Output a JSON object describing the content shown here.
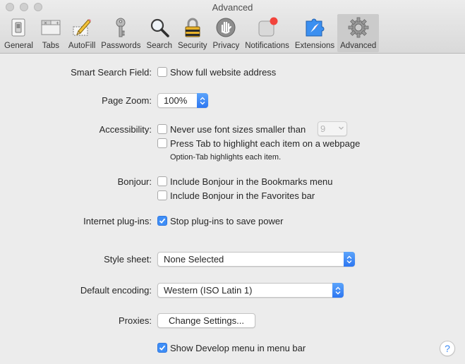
{
  "window": {
    "title": "Advanced"
  },
  "toolbar": {
    "items": [
      {
        "label": "General",
        "icon": "general-switch-icon"
      },
      {
        "label": "Tabs",
        "icon": "tabs-icon"
      },
      {
        "label": "AutoFill",
        "icon": "autofill-pencil-icon"
      },
      {
        "label": "Passwords",
        "icon": "key-icon"
      },
      {
        "label": "Search",
        "icon": "magnifier-icon"
      },
      {
        "label": "Security",
        "icon": "padlock-icon"
      },
      {
        "label": "Privacy",
        "icon": "hand-icon"
      },
      {
        "label": "Notifications",
        "icon": "notification-badge-icon"
      },
      {
        "label": "Extensions",
        "icon": "puzzle-compass-icon"
      },
      {
        "label": "Advanced",
        "icon": "gear-icon",
        "selected": true
      }
    ]
  },
  "settings": {
    "smart_search": {
      "label": "Smart Search Field:",
      "option": "Show full website address",
      "checked": false
    },
    "page_zoom": {
      "label": "Page Zoom:",
      "value": "100%"
    },
    "accessibility": {
      "label": "Accessibility:",
      "font_size_option": "Never use font sizes smaller than",
      "font_size_checked": false,
      "font_size_value": "9",
      "tab_option": "Press Tab to highlight each item on a webpage",
      "tab_checked": false,
      "tab_note": "Option-Tab highlights each item."
    },
    "bonjour": {
      "label": "Bonjour:",
      "bookmarks_option": "Include Bonjour in the Bookmarks menu",
      "bookmarks_checked": false,
      "favorites_option": "Include Bonjour in the Favorites bar",
      "favorites_checked": false
    },
    "plugins": {
      "label": "Internet plug-ins:",
      "option": "Stop plug-ins to save power",
      "checked": true
    },
    "style_sheet": {
      "label": "Style sheet:",
      "value": "None Selected"
    },
    "encoding": {
      "label": "Default encoding:",
      "value": "Western (ISO Latin 1)"
    },
    "proxies": {
      "label": "Proxies:",
      "button": "Change Settings..."
    },
    "develop": {
      "option": "Show Develop menu in menu bar",
      "checked": true
    }
  },
  "help": {
    "label": "?"
  },
  "colors": {
    "accent": "#3f8ef6",
    "selected_toolbar": "#cbcbcb",
    "background": "#ececec",
    "notification_red": "#f2443c"
  }
}
